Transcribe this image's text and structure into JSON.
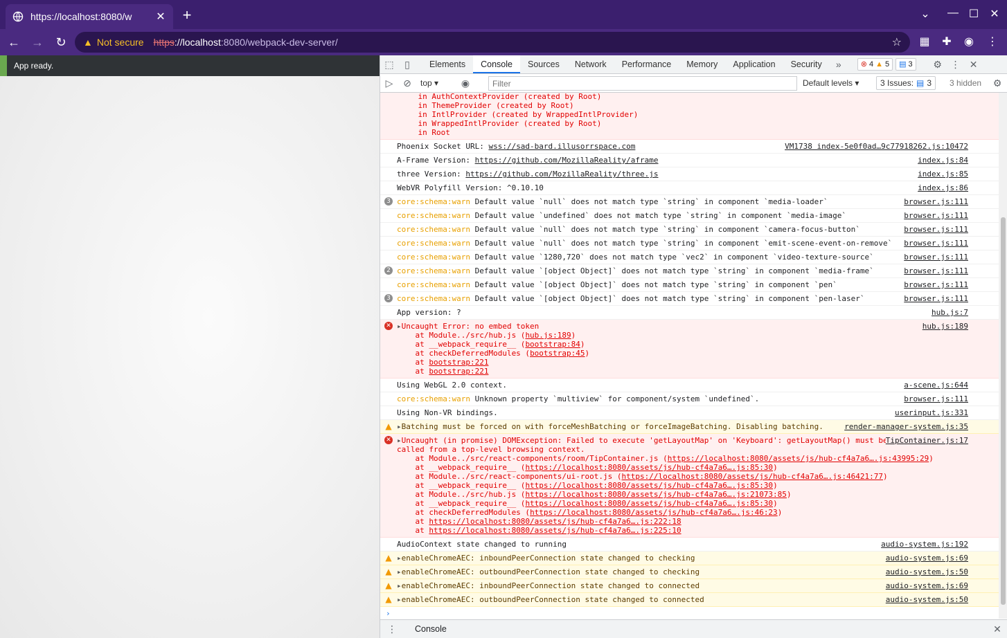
{
  "browser": {
    "tab_title": "https://localhost:8080/w",
    "url_scheme": "https",
    "url_host": "://localhost",
    "url_rest": ":8080/webpack-dev-server/",
    "not_secure": "Not secure"
  },
  "page": {
    "status": "App ready."
  },
  "devtools": {
    "tabs": [
      "Elements",
      "Console",
      "Sources",
      "Network",
      "Performance",
      "Memory",
      "Application",
      "Security"
    ],
    "active_tab": "Console",
    "err_count": "4",
    "warn_count": "5",
    "msg_count": "3",
    "context": "top",
    "filter_placeholder": "Filter",
    "levels": "Default levels",
    "issues": "3 Issues:",
    "issues_count": "3",
    "hidden": "3 hidden",
    "drawer": "Console"
  },
  "console": {
    "r0": "in AuthContextProvider (created by Root)\n    in ThemeProvider (created by Root)\n    in IntlProvider (created by WrappedIntlProvider)\n    in WrappedIntlProvider (created by Root)\n    in Root",
    "r1": "Phoenix Socket URL: ",
    "r1u": "wss://sad-bard.illusorrspace.com",
    "r1s": "VM1738 index-5e0f0ad…9c77918262.js:10472",
    "r2": "A-Frame Version: ",
    "r2u": "https://github.com/MozillaReality/aframe",
    "r2s": "index.js:84",
    "r3": "three Version: ",
    "r3u": "https://github.com/MozillaReality/three.js",
    "r3s": "index.js:85",
    "r4": "WebVR Polyfill Version: ^0.10.10",
    "r4s": "index.js:86",
    "sch": "core:schema:warn",
    "w1": " Default value `null` does not match type `string` in component `media-loader`",
    "w2": " Default value `undefined` does not match type `string` in component `media-image`",
    "w3": " Default value `null` does not match type `string` in component `camera-focus-button`",
    "w4": " Default value `null` does not match type `string` in component `emit-scene-event-on-remove`",
    "w5": " Default value `1280,720` does not match type `vec2` in component `video-texture-source`",
    "w6": " Default value `[object Object]` does not match type `string` in component `media-frame`",
    "w7": " Default value `[object Object]` does not match type `string` in component `pen`",
    "w8": " Default value `[object Object]` does not match type `string` in component `pen-laser`",
    "bs": "browser.js:111",
    "n1": "3",
    "n6": "2",
    "n8": "3",
    "appv": "App version: ?",
    "appvs": "hub.js:7",
    "e1": "Uncaught Error: no embed token",
    "e1s": "hub.js:189",
    "e1l1": "    at Module../src/hub.js (",
    "e1l1u": "hub.js:189",
    "e1l2": "    at __webpack_require__ (",
    "e1l2u": "bootstrap:84",
    "e1l3": "    at checkDeferredModules (",
    "e1l3u": "bootstrap:45",
    "e1l4": "    at ",
    "e1l4u": "bootstrap:221",
    "webgl": "Using WebGL 2.0 context.",
    "webgls": "a-scene.js:644",
    "mv": " Unknown property `multiview` for component/system `undefined`.",
    "nvr": "Using Non-VR bindings.",
    "nvrs": "userinput.js:331",
    "bat": "Batching must be forced on with forceMeshBatching or forceImageBatching. Disabling batching.",
    "bats": "render-manager-system.js:35",
    "e2": "Uncaught (in promise) DOMException: Failed to execute 'getLayoutMap' on 'Keyboard': getLayoutMap() must be\ncalled from a top-level browsing context.",
    "e2s": "TipContainer.js:17",
    "e2a": "    at Module../src/react-components/room/TipContainer.js (",
    "e2au": "https://localhost:8080/assets/js/hub-cf4a7a6….js:43995:29",
    "e2b": "    at __webpack_require__ (",
    "e2bu": "https://localhost:8080/assets/js/hub-cf4a7a6….js:85:30",
    "e2c": "    at Module../src/react-components/ui-root.js (",
    "e2cu": "https://localhost:8080/assets/js/hub-cf4a7a6….js:46421:77",
    "e2d": "    at Module../src/hub.js (",
    "e2du": "https://localhost:8080/assets/js/hub-cf4a7a6….js:21073:85",
    "e2e": "    at checkDeferredModules (",
    "e2eu": "https://localhost:8080/assets/js/hub-cf4a7a6….js:46:23",
    "e2f": "    at ",
    "e2fu": "https://localhost:8080/assets/js/hub-cf4a7a6….js:222:18",
    "e2gu": "https://localhost:8080/assets/js/hub-cf4a7a6….js:225:10",
    "ac": "AudioContext state changed to running",
    "acs": "audio-system.js:192",
    "a1": "enableChromeAEC: inboundPeerConnection state changed to checking",
    "a1s": "audio-system.js:69",
    "a2": "enableChromeAEC: outboundPeerConnection state changed to checking",
    "a2s": "audio-system.js:50",
    "a3": "enableChromeAEC: inboundPeerConnection state changed to connected",
    "a3s": "audio-system.js:69",
    "a4": "enableChromeAEC: outboundPeerConnection state changed to connected",
    "a4s": "audio-system.js:50",
    "close_paren": ")"
  }
}
